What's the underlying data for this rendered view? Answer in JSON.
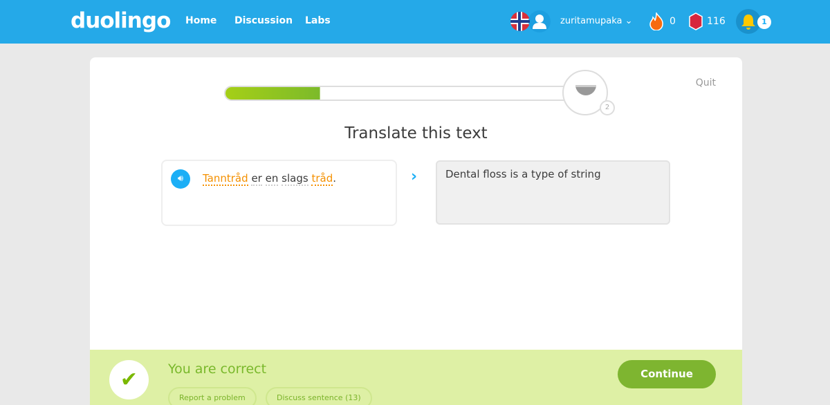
{
  "header": {
    "logo": "duolingo",
    "nav": [
      "Home",
      "Discussion",
      "Labs"
    ],
    "username": "zuritamupaka",
    "streak": "0",
    "gems": "116",
    "notifications": "1",
    "brand_color": "#25a9e8"
  },
  "lesson": {
    "quit": "Quit",
    "progress": 0.27,
    "checkpoint": "2",
    "title": "Translate this text",
    "sentence": [
      {
        "text": "Tanntråd",
        "hint": true
      },
      {
        "text": "er",
        "hint": false
      },
      {
        "text": "en",
        "hint": false
      },
      {
        "text": "slags",
        "hint": false
      },
      {
        "text": "tråd",
        "hint": true
      }
    ],
    "sentence_end": ".",
    "answer": "Dental floss is a type of string"
  },
  "footer": {
    "message": "You are correct",
    "report": "Report a problem",
    "discuss": "Discuss sentence (13)",
    "continue": "Continue"
  }
}
